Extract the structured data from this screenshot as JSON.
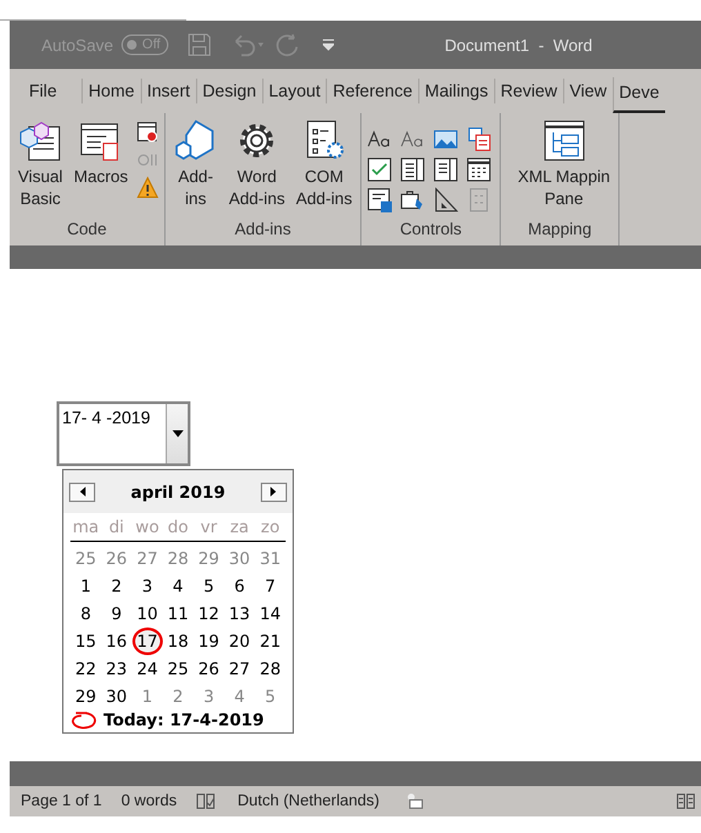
{
  "title_bar": {
    "autosave_label": "AutoSave",
    "autosave_toggle": {
      "label": "Off",
      "on": false
    },
    "title": "Document1  -  Word"
  },
  "tabs": [
    {
      "label": "File",
      "selected": false
    },
    {
      "label": "Home",
      "selected": false
    },
    {
      "label": "Insert",
      "selected": false
    },
    {
      "label": "Design",
      "selected": false
    },
    {
      "label": "Layout",
      "selected": false
    },
    {
      "label": "Reference",
      "selected": false
    },
    {
      "label": "Mailings",
      "selected": false
    },
    {
      "label": "Review",
      "selected": false
    },
    {
      "label": "View",
      "selected": false
    },
    {
      "label": "Deve",
      "selected": true
    }
  ],
  "ribbon_groups": [
    {
      "label": "Code",
      "kind": "code",
      "buttons": [
        {
          "kind": "visual-basic",
          "label": "Visual\nBasic"
        },
        {
          "kind": "macros",
          "label": "Macros"
        }
      ]
    },
    {
      "label": "Add-ins",
      "kind": "addins",
      "buttons": [
        {
          "kind": "addins",
          "label": "Add-\nins"
        },
        {
          "kind": "word-addins",
          "label": "Word\nAdd-ins"
        },
        {
          "kind": "com-addins",
          "label": "COM\nAdd-ins"
        }
      ]
    },
    {
      "label": "Controls",
      "kind": "controls"
    },
    {
      "label": "Mapping",
      "kind": "mapping",
      "buttons": [
        {
          "kind": "xml-mapping",
          "label": "XML Mappin\nPane"
        }
      ]
    }
  ],
  "date_picker": {
    "value": "17- 4 -2019"
  },
  "calendar": {
    "month_label": "april 2019",
    "weekdays": [
      "ma",
      "di",
      "wo",
      "do",
      "vr",
      "za",
      "zo"
    ],
    "weeks": [
      [
        {
          "day": "25",
          "muted": true,
          "selected": false
        },
        {
          "day": "26",
          "muted": true,
          "selected": false
        },
        {
          "day": "27",
          "muted": true,
          "selected": false
        },
        {
          "day": "28",
          "muted": true,
          "selected": false
        },
        {
          "day": "29",
          "muted": true,
          "selected": false
        },
        {
          "day": "30",
          "muted": true,
          "selected": false
        },
        {
          "day": "31",
          "muted": true,
          "selected": false
        }
      ],
      [
        {
          "day": "1",
          "muted": false,
          "selected": false
        },
        {
          "day": "2",
          "muted": false,
          "selected": false
        },
        {
          "day": "3",
          "muted": false,
          "selected": false
        },
        {
          "day": "4",
          "muted": false,
          "selected": false
        },
        {
          "day": "5",
          "muted": false,
          "selected": false
        },
        {
          "day": "6",
          "muted": false,
          "selected": false
        },
        {
          "day": "7",
          "muted": false,
          "selected": false
        }
      ],
      [
        {
          "day": "8",
          "muted": false,
          "selected": false
        },
        {
          "day": "9",
          "muted": false,
          "selected": false
        },
        {
          "day": "10",
          "muted": false,
          "selected": false
        },
        {
          "day": "11",
          "muted": false,
          "selected": false
        },
        {
          "day": "12",
          "muted": false,
          "selected": false
        },
        {
          "day": "13",
          "muted": false,
          "selected": false
        },
        {
          "day": "14",
          "muted": false,
          "selected": false
        }
      ],
      [
        {
          "day": "15",
          "muted": false,
          "selected": false
        },
        {
          "day": "16",
          "muted": false,
          "selected": false
        },
        {
          "day": "17",
          "muted": false,
          "selected": true
        },
        {
          "day": "18",
          "muted": false,
          "selected": false
        },
        {
          "day": "19",
          "muted": false,
          "selected": false
        },
        {
          "day": "20",
          "muted": false,
          "selected": false
        },
        {
          "day": "21",
          "muted": false,
          "selected": false
        }
      ],
      [
        {
          "day": "22",
          "muted": false,
          "selected": false
        },
        {
          "day": "23",
          "muted": false,
          "selected": false
        },
        {
          "day": "24",
          "muted": false,
          "selected": false
        },
        {
          "day": "25",
          "muted": false,
          "selected": false
        },
        {
          "day": "26",
          "muted": false,
          "selected": false
        },
        {
          "day": "27",
          "muted": false,
          "selected": false
        },
        {
          "day": "28",
          "muted": false,
          "selected": false
        }
      ],
      [
        {
          "day": "29",
          "muted": false,
          "selected": false
        },
        {
          "day": "30",
          "muted": false,
          "selected": false
        },
        {
          "day": "1",
          "muted": true,
          "selected": false
        },
        {
          "day": "2",
          "muted": true,
          "selected": false
        },
        {
          "day": "3",
          "muted": true,
          "selected": false
        },
        {
          "day": "4",
          "muted": true,
          "selected": false
        },
        {
          "day": "5",
          "muted": true,
          "selected": false
        }
      ]
    ],
    "today_label": "Today: 17-4-2019"
  },
  "status_bar": {
    "page": "Page 1 of 1",
    "words": "0 words",
    "language": "Dutch (Netherlands)"
  }
}
